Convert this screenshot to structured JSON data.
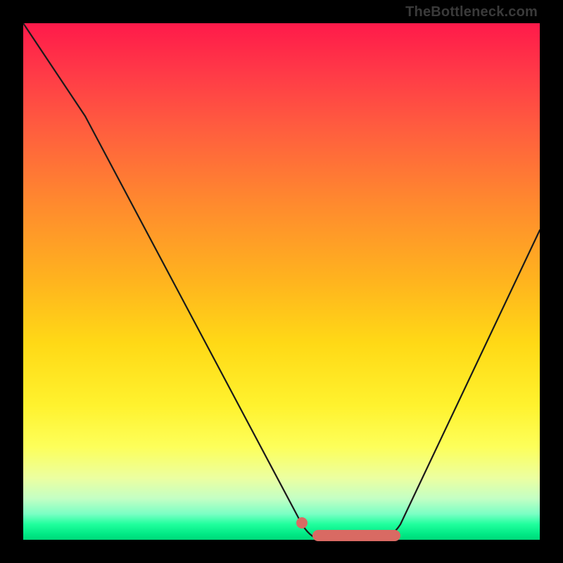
{
  "watermark": "TheBottleneck.com",
  "chart_data": {
    "type": "line",
    "title": "",
    "xlabel": "",
    "ylabel": "",
    "xlim": [
      0,
      100
    ],
    "ylim": [
      0,
      100
    ],
    "grid": false,
    "series": [
      {
        "name": "bottleneck-curve",
        "x": [
          0,
          12,
          54,
          58,
          68,
          73,
          100
        ],
        "values": [
          100,
          82,
          3,
          0,
          0,
          3,
          60
        ]
      }
    ],
    "annotations": [
      {
        "name": "optimal-range-bar",
        "x_start": 56,
        "x_end": 73,
        "y": 0.5
      },
      {
        "name": "optimal-range-dot",
        "x": 54,
        "y": 3
      }
    ],
    "colors": {
      "curve": "#1a1a1a",
      "marker": "#d96a63",
      "gradient_top": "#ff1a4a",
      "gradient_bottom": "#00d87a"
    }
  }
}
